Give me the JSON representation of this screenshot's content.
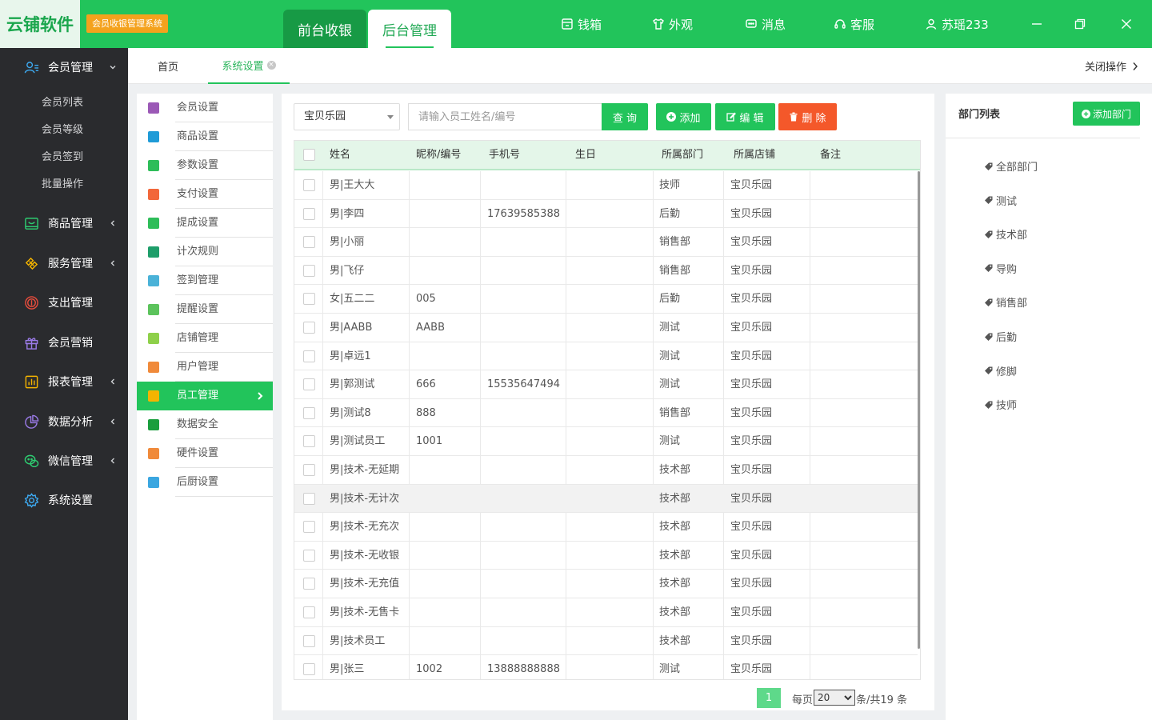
{
  "app": {
    "logo": "云铺软件",
    "badge": "会员收银管理系统",
    "mode_front": "前台收银",
    "mode_back": "后台管理"
  },
  "top_nav": [
    {
      "label": "钱箱",
      "icon": "cash-box-icon"
    },
    {
      "label": "外观",
      "icon": "shirt-icon"
    },
    {
      "label": "消息",
      "icon": "message-icon"
    },
    {
      "label": "客服",
      "icon": "headset-icon"
    },
    {
      "label": "苏瑶233",
      "icon": "user-icon"
    }
  ],
  "sidebar": {
    "groups": [
      {
        "label": "会员管理",
        "icon": "member-icon",
        "expanded": true,
        "subs": [
          "会员列表",
          "会员等级",
          "会员签到",
          "批量操作"
        ]
      },
      {
        "label": "商品管理",
        "icon": "goods-icon"
      },
      {
        "label": "服务管理",
        "icon": "service-icon"
      },
      {
        "label": "支出管理",
        "icon": "expense-icon"
      },
      {
        "label": "会员营销",
        "icon": "gift-icon"
      },
      {
        "label": "报表管理",
        "icon": "report-icon"
      },
      {
        "label": "数据分析",
        "icon": "pie-chart-icon"
      },
      {
        "label": "微信管理",
        "icon": "wechat-icon"
      },
      {
        "label": "系统设置",
        "icon": "gear-icon"
      }
    ]
  },
  "tabs": {
    "home": "首页",
    "active": "系统设置",
    "close_ops": "关闭操作"
  },
  "settings_menu": [
    {
      "label": "会员设置",
      "color": "#9b59b6"
    },
    {
      "label": "商品设置",
      "color": "#1f9bd7"
    },
    {
      "label": "参数设置",
      "color": "#2ebd59"
    },
    {
      "label": "支付设置",
      "color": "#f2673a"
    },
    {
      "label": "提成设置",
      "color": "#2ebd59"
    },
    {
      "label": "计次规则",
      "color": "#1e9e6a"
    },
    {
      "label": "签到管理",
      "color": "#4ab2d8"
    },
    {
      "label": "提醒设置",
      "color": "#5cc35c"
    },
    {
      "label": "店铺管理",
      "color": "#8ed04a"
    },
    {
      "label": "用户管理",
      "color": "#f08a3a"
    },
    {
      "label": "员工管理",
      "color": "#f4b400",
      "active": true
    },
    {
      "label": "数据安全",
      "color": "#1a9e3d"
    },
    {
      "label": "硬件设置",
      "color": "#f08a3a"
    },
    {
      "label": "后厨设置",
      "color": "#3aa6e0"
    }
  ],
  "toolbar": {
    "store": "宝贝乐园",
    "search_placeholder": "请输入员工姓名/编号",
    "query": "查 询",
    "add": "添加",
    "edit": "编 辑",
    "delete": "删 除"
  },
  "table": {
    "headers": [
      "姓名",
      "昵称/编号",
      "手机号",
      "生日",
      "所属部门",
      "所属店铺",
      "备注"
    ],
    "rows": [
      [
        "男|王大大",
        "",
        "",
        "",
        "技师",
        "宝贝乐园",
        ""
      ],
      [
        "男|李四",
        "",
        "17639585388",
        "",
        "后勤",
        "宝贝乐园",
        ""
      ],
      [
        "男|小丽",
        "",
        "",
        "",
        "销售部",
        "宝贝乐园",
        ""
      ],
      [
        "男|飞仔",
        "",
        "",
        "",
        "销售部",
        "宝贝乐园",
        ""
      ],
      [
        "女|五二二",
        "005",
        "",
        "",
        "后勤",
        "宝贝乐园",
        ""
      ],
      [
        "男|AABB",
        "AABB",
        "",
        "",
        "测试",
        "宝贝乐园",
        ""
      ],
      [
        "男|卓远1",
        "",
        "",
        "",
        "测试",
        "宝贝乐园",
        ""
      ],
      [
        "男|郭测试",
        "666",
        "15535647494",
        "",
        "测试",
        "宝贝乐园",
        ""
      ],
      [
        "男|测试8",
        "888",
        "",
        "",
        "销售部",
        "宝贝乐园",
        ""
      ],
      [
        "男|测试员工",
        "1001",
        "",
        "",
        "测试",
        "宝贝乐园",
        ""
      ],
      [
        "男|技术-无延期",
        "",
        "",
        "",
        "技术部",
        "宝贝乐园",
        ""
      ],
      [
        "男|技术-无计次",
        "",
        "",
        "",
        "技术部",
        "宝贝乐园",
        ""
      ],
      [
        "男|技术-无充次",
        "",
        "",
        "",
        "技术部",
        "宝贝乐园",
        ""
      ],
      [
        "男|技术-无收银",
        "",
        "",
        "",
        "技术部",
        "宝贝乐园",
        ""
      ],
      [
        "男|技术-无充值",
        "",
        "",
        "",
        "技术部",
        "宝贝乐园",
        ""
      ],
      [
        "男|技术-无售卡",
        "",
        "",
        "",
        "技术部",
        "宝贝乐园",
        ""
      ],
      [
        "男|技术员工",
        "",
        "",
        "",
        "技术部",
        "宝贝乐园",
        ""
      ],
      [
        "男|张三",
        "1002",
        "13888888888",
        "",
        "测试",
        "宝贝乐园",
        ""
      ]
    ]
  },
  "pagination": {
    "current_page": "1",
    "per_page_label": "每页",
    "per_page": "20",
    "total": "条/共19 条"
  },
  "departments": {
    "title": "部门列表",
    "add_button": "添加部门",
    "items": [
      "全部部门",
      "测试",
      "技术部",
      "导购",
      "销售部",
      "后勤",
      "修脚",
      "技师"
    ]
  },
  "colors": {
    "brand_green": "#22c45b",
    "sidebar_bg": "#2a2b2e",
    "delete_orange": "#f4582a",
    "badge_orange": "#f4a21d"
  }
}
